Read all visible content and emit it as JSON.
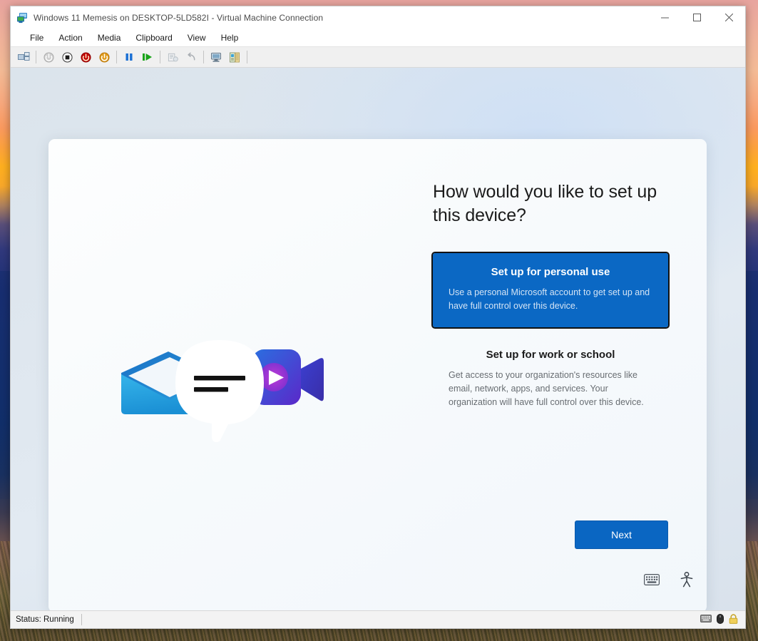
{
  "window": {
    "title": "Windows 11 Memesis on DESKTOP-5LD582I - Virtual Machine Connection",
    "app_icon": "virtual-machine-icon",
    "controls": {
      "minimize": "—",
      "maximize": "☐",
      "close": "✕"
    }
  },
  "menubar": {
    "items": [
      {
        "label": "File"
      },
      {
        "label": "Action"
      },
      {
        "label": "Media"
      },
      {
        "label": "Clipboard"
      },
      {
        "label": "View"
      },
      {
        "label": "Help"
      }
    ]
  },
  "toolbar": {
    "buttons": [
      {
        "name": "ctrl-alt-delete-icon",
        "title": "Ctrl+Alt+Delete"
      },
      {
        "name": "start-icon",
        "title": "Start"
      },
      {
        "name": "turn-off-icon",
        "title": "Turn Off"
      },
      {
        "name": "shut-down-icon",
        "title": "Shut Down"
      },
      {
        "name": "save-icon",
        "title": "Save"
      },
      {
        "name": "pause-icon",
        "title": "Pause"
      },
      {
        "name": "reset-icon",
        "title": "Reset"
      },
      {
        "name": "checkpoint-icon",
        "title": "Checkpoint"
      },
      {
        "name": "revert-icon",
        "title": "Revert"
      },
      {
        "name": "enhanced-session-icon",
        "title": "Enhanced Session"
      },
      {
        "name": "settings-icon",
        "title": "Settings"
      }
    ],
    "colors": {
      "turn_off": "#c00000",
      "shut_down": "#e09a1a",
      "pause": "#1a6fd4",
      "reset": "#19a319"
    }
  },
  "oobe": {
    "heading": "How would you like to set up this device?",
    "options": [
      {
        "id": "personal",
        "title": "Set up for personal use",
        "description": "Use a personal Microsoft account to get set up and have full control over this device.",
        "selected": true
      },
      {
        "id": "work",
        "title": "Set up for work or school",
        "description": "Get access to your organization's resources like email, network, apps, and services. Your organization will have full control over this device.",
        "selected": false
      }
    ],
    "next_label": "Next",
    "accent_color": "#0a66c2",
    "selected_card_color": "#0b68c4",
    "illustration": {
      "name": "mail-chat-video-illustration",
      "parts": [
        "envelope-icon",
        "speech-bubble-icon",
        "video-camera-icon"
      ]
    },
    "corner_icons": [
      {
        "name": "touch-keyboard-icon"
      },
      {
        "name": "accessibility-icon"
      }
    ]
  },
  "statusbar": {
    "status": "Status: Running",
    "icons": [
      {
        "name": "keyboard-icon"
      },
      {
        "name": "mouse-icon"
      },
      {
        "name": "lock-icon"
      }
    ]
  }
}
